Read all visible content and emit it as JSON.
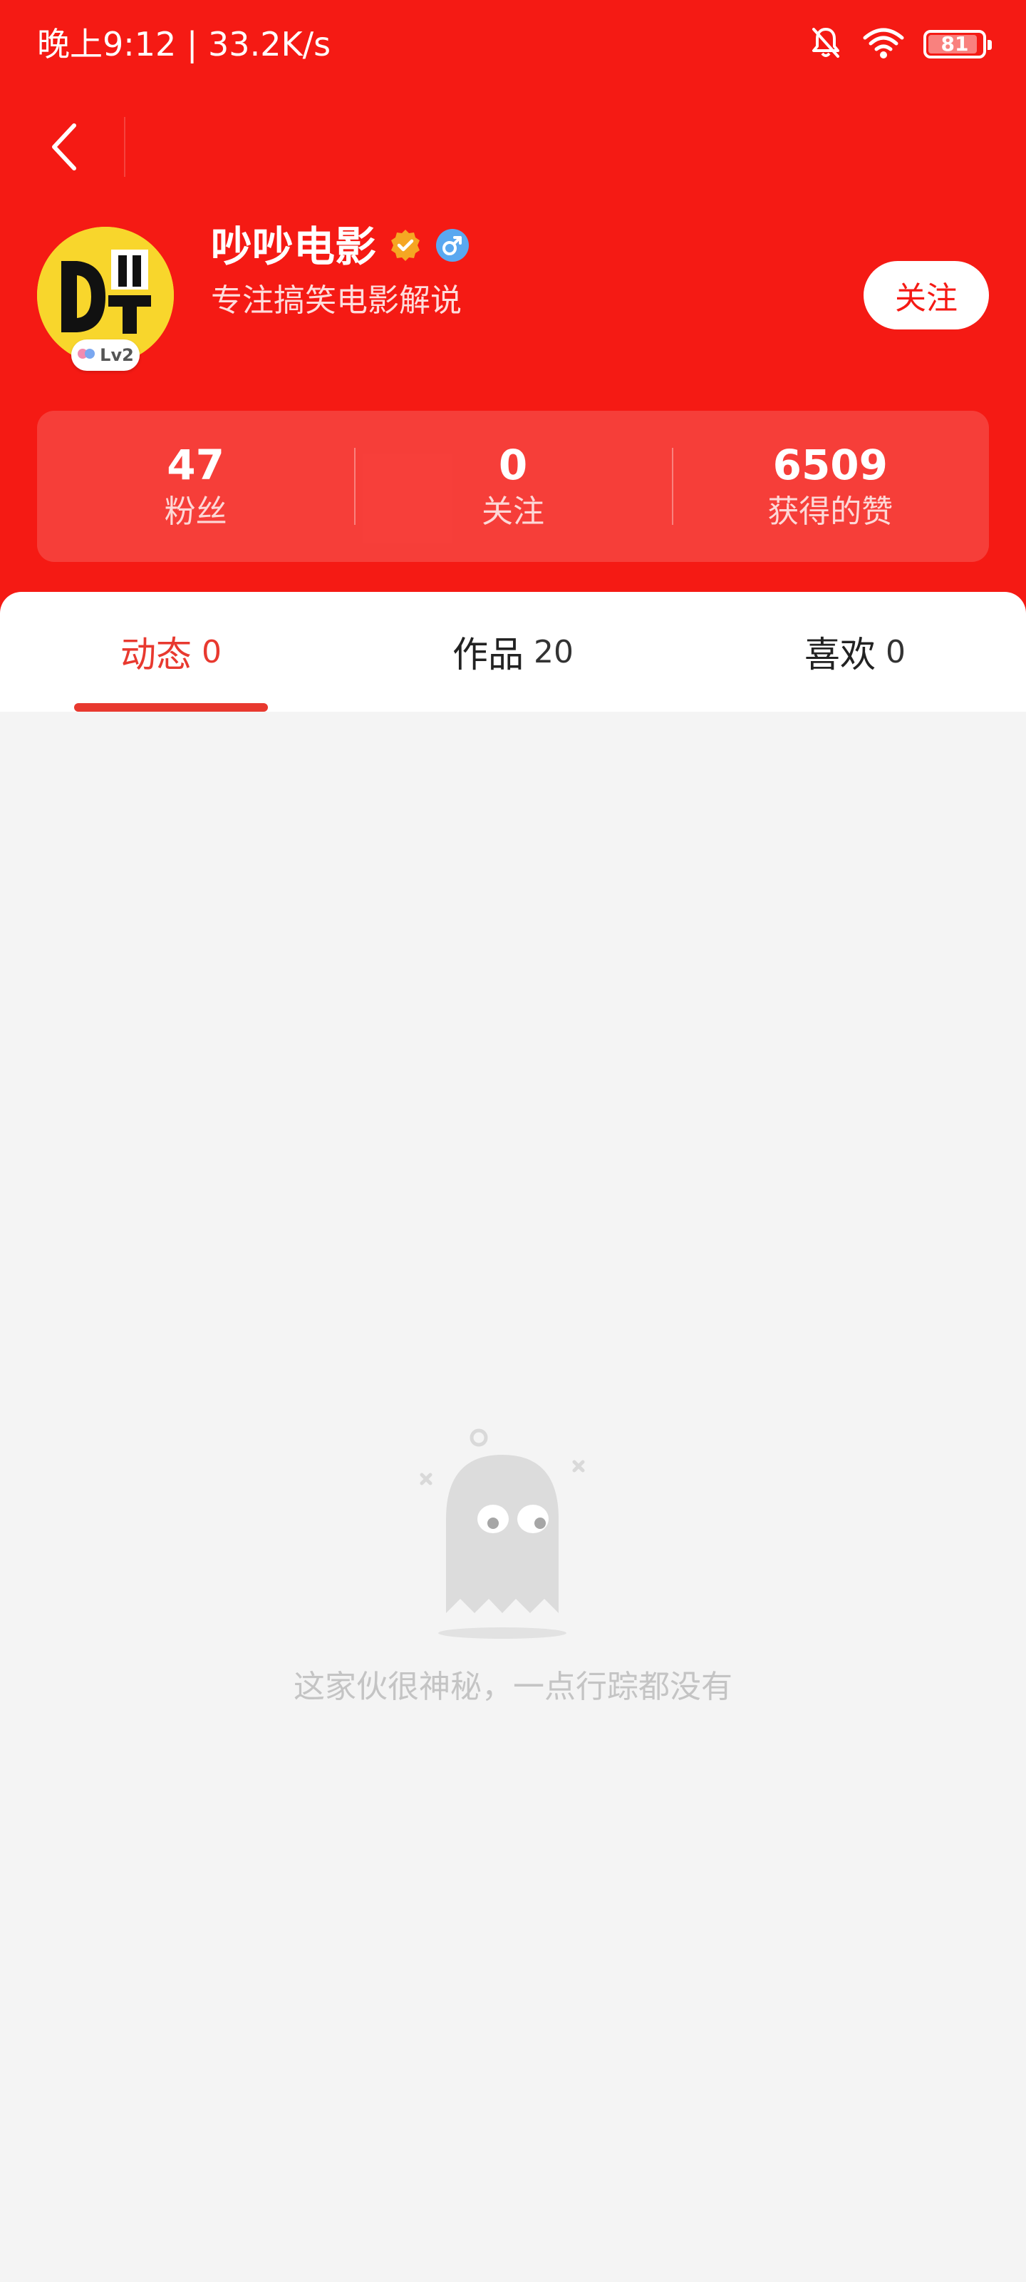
{
  "status_bar": {
    "time_speed": "晚上9:12 | 33.2K/s",
    "icons": [
      "bell-off-icon",
      "wifi-icon",
      "battery-icon"
    ],
    "battery": "81"
  },
  "nav": {
    "back_icon": "chevron-left-icon"
  },
  "profile": {
    "name": "吵吵电影",
    "bio": "专注搞笑电影解说",
    "level": "Lv2",
    "verified_icon": "verified-badge-icon",
    "gender_icon": "male-icon",
    "follow_label": "关注"
  },
  "stats": [
    {
      "value": "47",
      "label": "粉丝"
    },
    {
      "value": "0",
      "label": "关注"
    },
    {
      "value": "6509",
      "label": "获得的赞"
    }
  ],
  "tabs": [
    {
      "label": "动态",
      "count": "0",
      "active": true
    },
    {
      "label": "作品",
      "count": "20",
      "active": false
    },
    {
      "label": "喜欢",
      "count": "0",
      "active": false
    }
  ],
  "empty_state": {
    "icon": "ghost-icon",
    "text": "这家伙很神秘，一点行踪都没有"
  },
  "colors": {
    "header_bg": "#f51a14",
    "accent": "#e8392f",
    "page_bg": "#f4f4f4",
    "empty_text": "#c4c4c4",
    "verified": "#f5a623",
    "gender_badge": "#5aa8f0"
  }
}
